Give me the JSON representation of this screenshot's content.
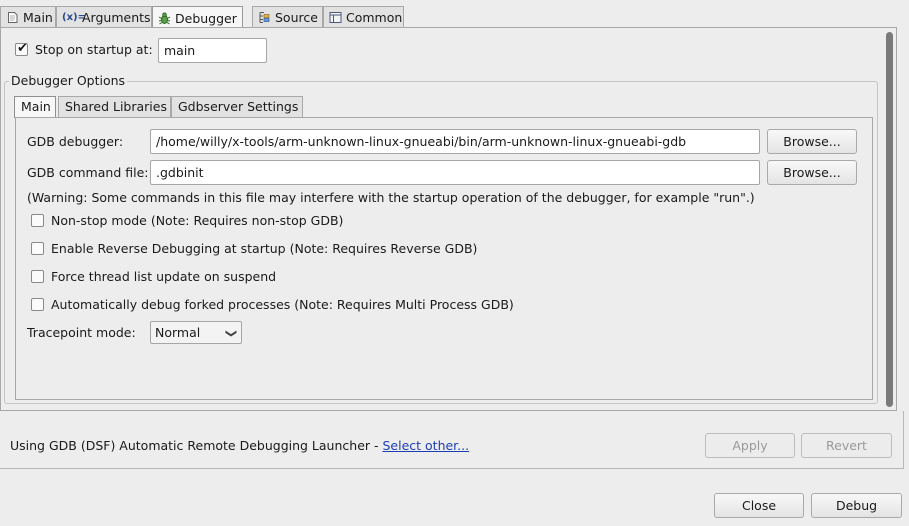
{
  "tabs": [
    {
      "label": "Main",
      "icon": "main-tab-icon"
    },
    {
      "label": "Arguments",
      "icon": "arguments-icon"
    },
    {
      "label": "Debugger",
      "icon": "bug-icon",
      "active": true
    },
    {
      "label": "Source",
      "icon": "source-icon"
    },
    {
      "label": "Common",
      "icon": "common-icon"
    }
  ],
  "stop_on_startup": {
    "label": "Stop on startup at:",
    "checked": true,
    "value": "main"
  },
  "debugger_options": {
    "title": "Debugger Options",
    "tabs": [
      {
        "label": "Main",
        "active": true
      },
      {
        "label": "Shared Libraries"
      },
      {
        "label": "Gdbserver Settings"
      }
    ],
    "gdb_debugger": {
      "label": "GDB debugger:",
      "value": "/home/willy/x-tools/arm-unknown-linux-gnueabi/bin/arm-unknown-linux-gnueabi-gdb",
      "browse": "Browse..."
    },
    "gdb_command_file": {
      "label": "GDB command file:",
      "value": ".gdbinit",
      "browse": "Browse..."
    },
    "warning": "(Warning: Some commands in this file may interfere with the startup operation of the debugger, for example \"run\".)",
    "options": [
      {
        "label": "Non-stop mode (Note: Requires non-stop GDB)",
        "checked": false
      },
      {
        "label": "Enable Reverse Debugging at startup (Note: Requires Reverse GDB)",
        "checked": false
      },
      {
        "label": "Force thread list update on suspend",
        "checked": false
      },
      {
        "label": "Automatically debug forked processes (Note: Requires Multi Process GDB)",
        "checked": false
      }
    ],
    "tracepoint": {
      "label": "Tracepoint mode:",
      "value": "Normal"
    }
  },
  "launcher": {
    "text": "Using GDB (DSF) Automatic Remote Debugging Launcher - ",
    "link": "Select other..."
  },
  "buttons": {
    "apply": "Apply",
    "revert": "Revert",
    "close": "Close",
    "debug": "Debug"
  },
  "colors": {
    "link": "#1c3eb5",
    "background": "#ededed"
  }
}
